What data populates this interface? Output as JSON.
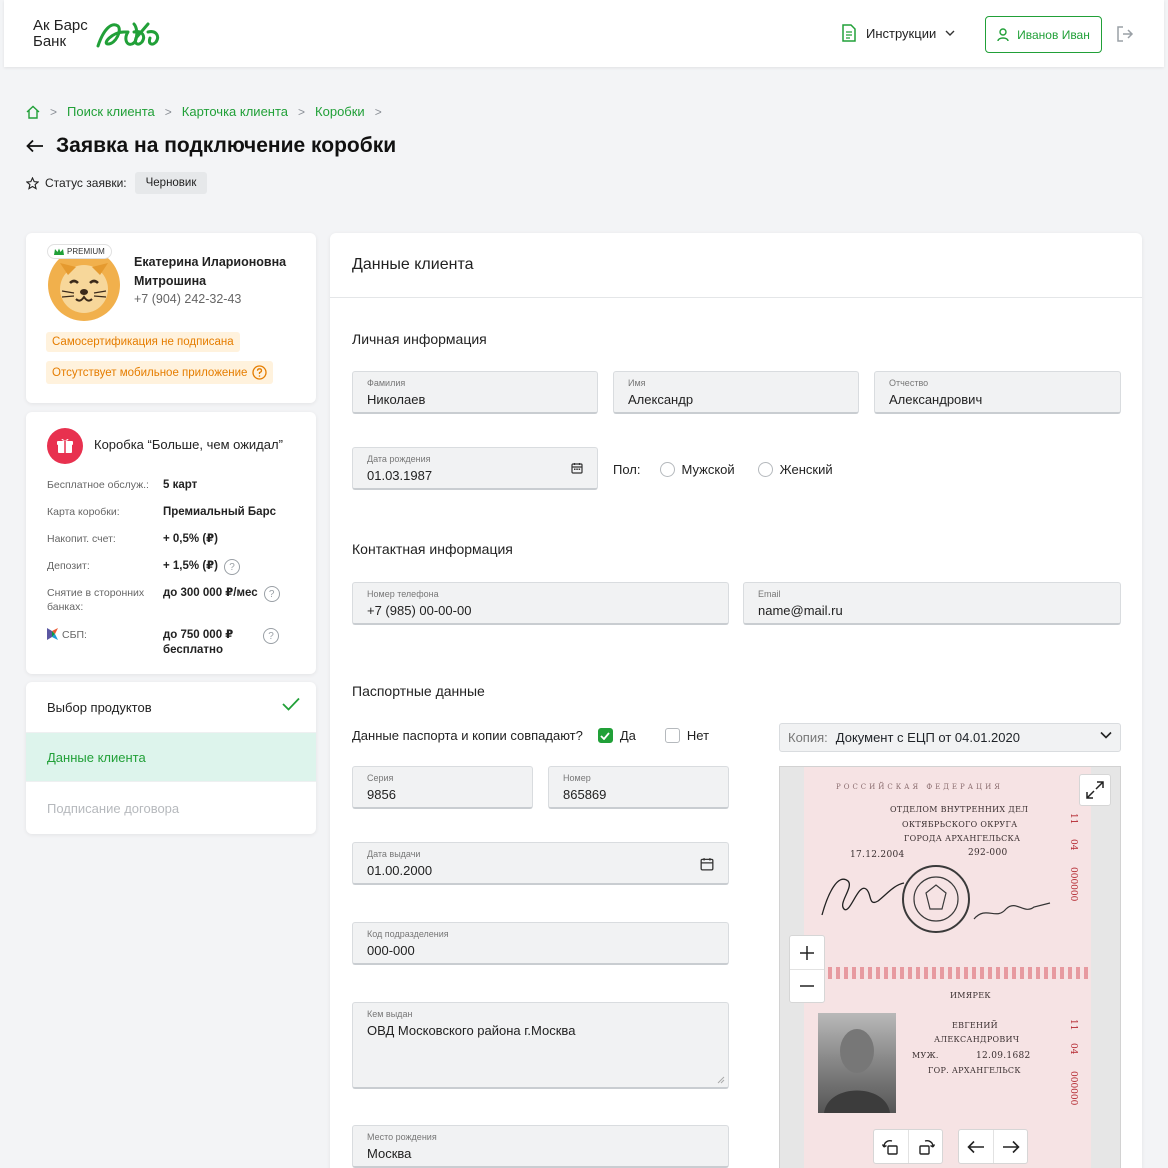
{
  "header": {
    "logo_line1": "Ак Барс",
    "logo_line2": "Банк",
    "instructions_label": "Инструкции",
    "user_name": "Иванов Иван"
  },
  "breadcrumb": [
    "Поиск клиента",
    "Карточка клиента",
    "Коробки"
  ],
  "page": {
    "title": "Заявка на подключение коробки",
    "status_label": "Статус заявки:",
    "status_value": "Черновик"
  },
  "client": {
    "badge": "PREMIUM",
    "name": "Екатерина Иларионовна Митрошина",
    "phone": "+7 (904) 242-32-43",
    "warnings": [
      "Самосертификация не подписана",
      "Отсутствует мобильное приложение"
    ]
  },
  "box": {
    "title": "Коробка “Больше, чем ожидал”",
    "rows": [
      {
        "label": "Бесплатное обслуж.:",
        "value": "5 карт",
        "help": false
      },
      {
        "label": "Карта коробки:",
        "value": "Премиальный Барс",
        "help": false
      },
      {
        "label": "Накопит. счет:",
        "value": "+ 0,5% (₽)",
        "help": false
      },
      {
        "label": "Депозит:",
        "value": "+ 1,5% (₽)",
        "help": true
      },
      {
        "label": "Снятие в сторонних банках:",
        "value": "до 300 000 ₽/мес",
        "help": true
      },
      {
        "label": "СБП:",
        "value": "до 750 000 ₽ бесплатно",
        "help": true
      }
    ]
  },
  "steps": [
    {
      "label": "Выбор продуктов",
      "state": "done"
    },
    {
      "label": "Данные клиента",
      "state": "active"
    },
    {
      "label": "Подписание договора",
      "state": "disabled"
    }
  ],
  "main": {
    "title": "Данные клиента",
    "personal": {
      "title": "Личная информация",
      "last_name": {
        "label": "Фамилия",
        "value": "Николаев"
      },
      "first_name": {
        "label": "Имя",
        "value": "Александр"
      },
      "patronymic": {
        "label": "Отчество",
        "value": "Александрович"
      },
      "birth_date": {
        "label": "Дата рождения",
        "value": "01.03.1987"
      },
      "gender_label": "Пол:",
      "gender_options": [
        "Мужской",
        "Женский"
      ]
    },
    "contact": {
      "title": "Контактная информация",
      "phone": {
        "label": "Номер телефона",
        "value": "+7 (985) 00-00-00"
      },
      "email": {
        "label": "Email",
        "value": "name@mail.ru"
      }
    },
    "passport": {
      "title": "Паспортные данные",
      "match_question": "Данные паспорта и копии совпадают?",
      "match_yes": "Да",
      "match_no": "Нет",
      "series": {
        "label": "Серия",
        "value": "9856"
      },
      "number": {
        "label": "Номер",
        "value": "865869"
      },
      "issue_date": {
        "label": "Дата выдачи",
        "value": "01.00.2000"
      },
      "division_code": {
        "label": "Код подразделения",
        "value": "000-000"
      },
      "issued_by": {
        "label": "Кем выдан",
        "value": "ОВД Московского района г.Москва"
      },
      "birth_place": {
        "label": "Место рождения",
        "value": "Москва"
      },
      "copy_label": "Копия:",
      "copy_value": "Документ с ЕЦП от 04.01.2020"
    }
  },
  "passport_image": {
    "header": "РОССИЙСКАЯ ФЕДЕРАЦИЯ",
    "issuer_1": "ОТДЕЛОМ ВНУТРЕННИХ ДЕЛ",
    "issuer_2": "ОКТЯБРЬСКОГО ОКРУГА",
    "issuer_3": "ГОРОДА АРХАНГЕЛЬСКА",
    "issue_date": "17.12.2004",
    "code": "292-000",
    "surname": "ИМЯРЕК",
    "name": "ЕВГЕНИЙ",
    "patronymic": "АЛЕКСАНДРОВИЧ",
    "sex": "МУЖ.",
    "birth_date": "12.09.1682",
    "birth_place": "ГОР. АРХАНГЕЛЬСК",
    "side_number_a": "11",
    "side_number_b": "04",
    "side_number_c": "000000"
  },
  "colors": {
    "accent": "#21a038",
    "warning": "#e57d00",
    "box_icon": "#e8314f",
    "active_step_bg": "#ddf4ec"
  }
}
